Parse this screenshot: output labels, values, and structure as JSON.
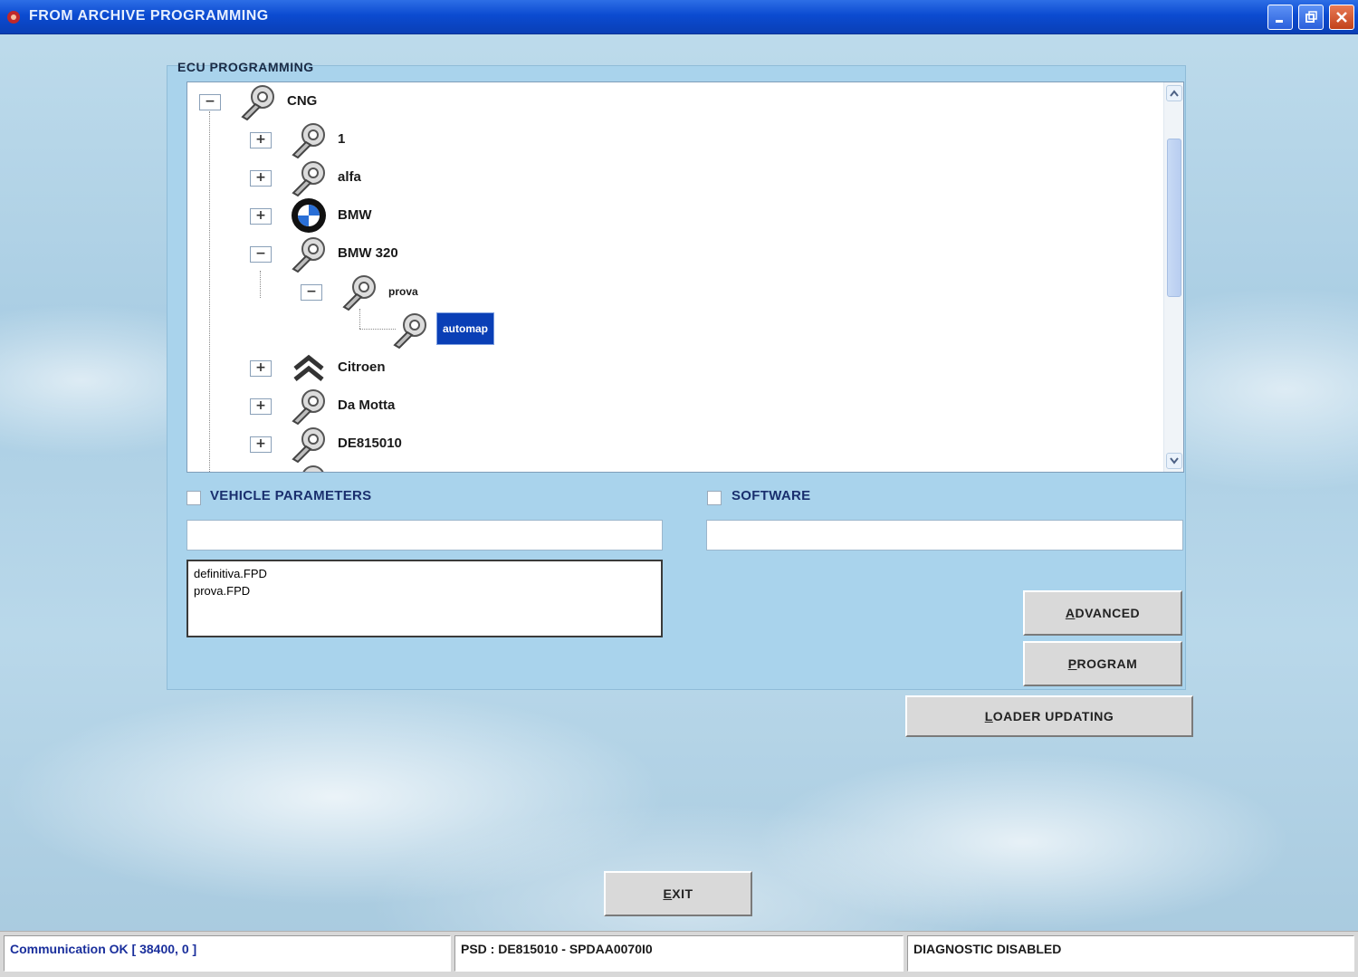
{
  "window": {
    "title": "FROM ARCHIVE PROGRAMMING"
  },
  "panel": {
    "title": "ECU PROGRAMMING"
  },
  "tree": {
    "nodes": [
      {
        "label": "CNG",
        "icon": "wrench-icon",
        "expander": "−"
      },
      {
        "label": "1",
        "icon": "wrench-icon",
        "expander": "+"
      },
      {
        "label": "alfa",
        "icon": "wrench-icon",
        "expander": "+"
      },
      {
        "label": "BMW",
        "icon": "bmw-logo-icon",
        "expander": "+"
      },
      {
        "label": "BMW 320",
        "icon": "wrench-icon",
        "expander": "−"
      },
      {
        "label": "prova",
        "icon": "wrench-icon",
        "expander": "−"
      },
      {
        "label": "automap",
        "icon": "wrench-icon",
        "selected": true
      },
      {
        "label": "Citroen",
        "icon": "citroen-logo-icon",
        "expander": "+"
      },
      {
        "label": "Da Motta",
        "icon": "wrench-icon",
        "expander": "+"
      },
      {
        "label": "DE815010",
        "icon": "wrench-icon",
        "expander": "+"
      }
    ]
  },
  "vehicle_parameters": {
    "label": "VEHICLE PARAMETERS",
    "checked": false,
    "value": "",
    "files": [
      "definitiva.FPD",
      "prova.FPD"
    ]
  },
  "software": {
    "label": "SOFTWARE",
    "checked": false,
    "value": ""
  },
  "buttons": {
    "advanced_first": "A",
    "advanced_rest": "DVANCED",
    "program_first": "P",
    "program_rest": "ROGRAM",
    "loader_first": "L",
    "loader_rest": "OADER UPDATING",
    "exit_first": "E",
    "exit_rest": "XIT"
  },
  "status": {
    "communication": "Communication OK [ 38400,  0 ]",
    "psd": "PSD : DE815010 - SPDAA0070I0",
    "diagnostic": "DIAGNOSTIC DISABLED"
  },
  "colors": {
    "titlebar": "#0b4bd1",
    "selection": "#0a3fb6",
    "panel": "#a9d3ec"
  }
}
